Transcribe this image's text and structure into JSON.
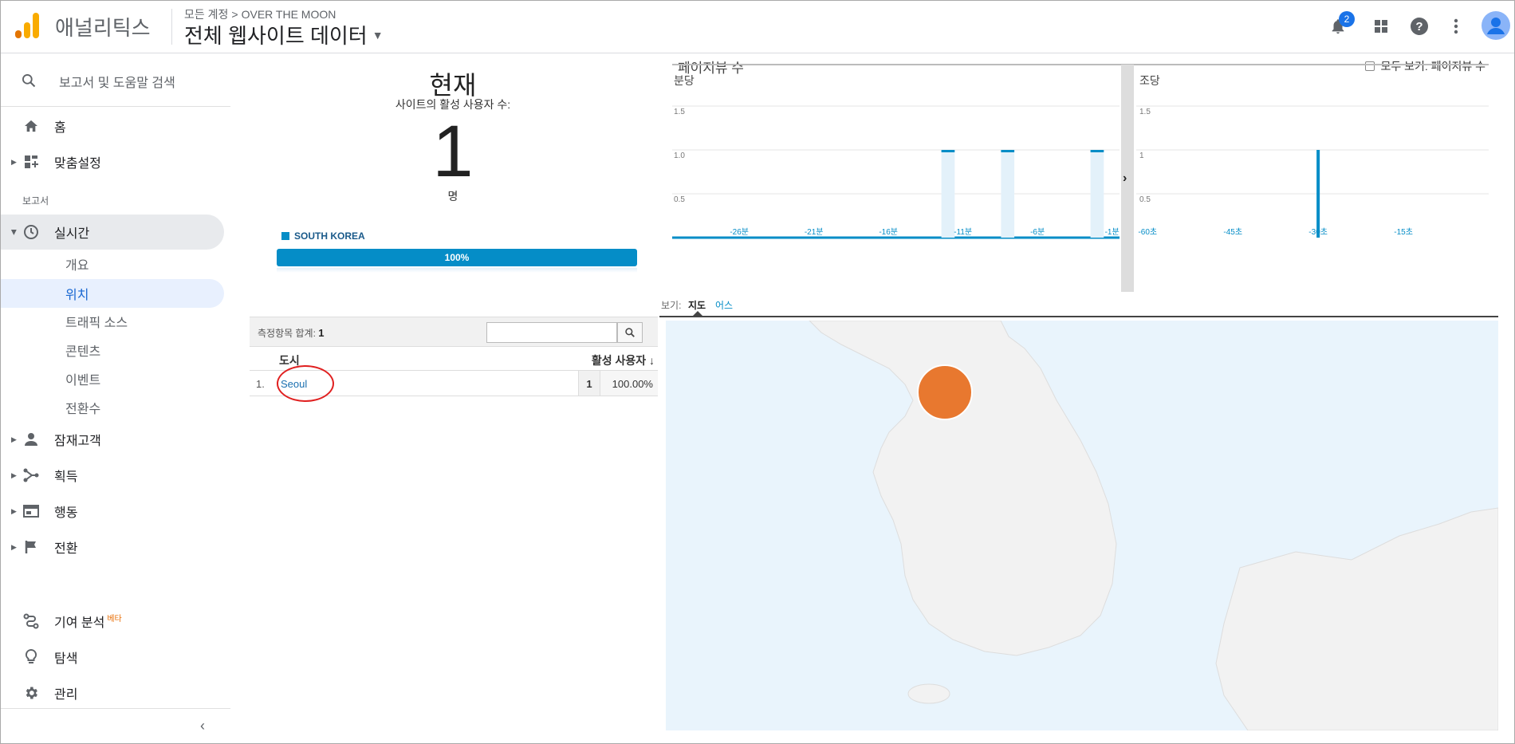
{
  "header": {
    "app_title": "애널리틱스",
    "breadcrumb_account": "모든 계정",
    "breadcrumb_sep": ">",
    "breadcrumb_property": "OVER THE MOON",
    "view_name": "전체 웹사이트 데이터",
    "notification_count": "2",
    "brand_colors": [
      "#f9ab00",
      "#e37400"
    ]
  },
  "sidebar": {
    "search_label": "보고서 및 도움말 검색",
    "home": "홈",
    "customization": "맞춤설정",
    "reports_section": "보고서",
    "realtime": "실시간",
    "realtime_items": [
      "개요",
      "위치",
      "트래픽 소스",
      "콘텐츠",
      "이벤트",
      "전환수"
    ],
    "audience": "잠재고객",
    "acquisition": "획득",
    "behavior": "행동",
    "conversions": "전환",
    "attribution": "기여 분석",
    "attribution_badge": "베타",
    "discover": "탐색",
    "admin": "관리"
  },
  "realtime": {
    "now_label": "현재",
    "active_users_label": "사이트의 활성 사용자 수:",
    "active_users": "1",
    "unit": "명",
    "country": "SOUTH KOREA",
    "country_percent": "100%",
    "accent_color": "#058dc7"
  },
  "table": {
    "total_label": "측정항목 합계:",
    "total_value": "1",
    "col_city": "도시",
    "col_active": "활성 사용자",
    "rows": [
      {
        "index": "1.",
        "city": "Seoul",
        "active": "1",
        "percent": "100.00%"
      }
    ]
  },
  "chart_area": {
    "title": "페이지뷰 수",
    "show_all_label": "모두 보기: 페이지뷰 수"
  },
  "chart_data": [
    {
      "type": "bar",
      "title": "분당",
      "categories": [
        "-30분",
        "-29분",
        "-28분",
        "-27분",
        "-26분",
        "-25분",
        "-24분",
        "-23분",
        "-22분",
        "-21분",
        "-20분",
        "-19분",
        "-18분",
        "-17분",
        "-16분",
        "-15분",
        "-14분",
        "-13분",
        "-12분",
        "-11분",
        "-10분",
        "-9분",
        "-8분",
        "-7분",
        "-6분",
        "-5분",
        "-4분",
        "-3분",
        "-2분",
        "-1분"
      ],
      "values": [
        0,
        0,
        0,
        0,
        0,
        0,
        0,
        0,
        0,
        0,
        0,
        0,
        0,
        0,
        0,
        0,
        0,
        0,
        1,
        0,
        0,
        0,
        1,
        0,
        0,
        0,
        0,
        0,
        1,
        0
      ],
      "x_tick_labels": [
        "-26분",
        "-21분",
        "-16분",
        "-11분",
        "-6분",
        "-1분"
      ],
      "y_ticks": [
        "0.5",
        "1.0",
        "1.5"
      ],
      "ylim": [
        0,
        2
      ]
    },
    {
      "type": "bar",
      "title": "조당",
      "categories_range_seconds": [
        -60,
        -1
      ],
      "values": [
        {
          "x": -30,
          "y": 1
        }
      ],
      "x_tick_labels": [
        "-60초",
        "-45초",
        "-30초",
        "-15초"
      ],
      "y_ticks": [
        "0.5",
        "1",
        "1.5"
      ],
      "ylim": [
        0,
        2
      ]
    }
  ],
  "map_view": {
    "view_label": "보기:",
    "tab_map": "지도",
    "tab_other": "어스",
    "marker_color": "#e8782f"
  }
}
